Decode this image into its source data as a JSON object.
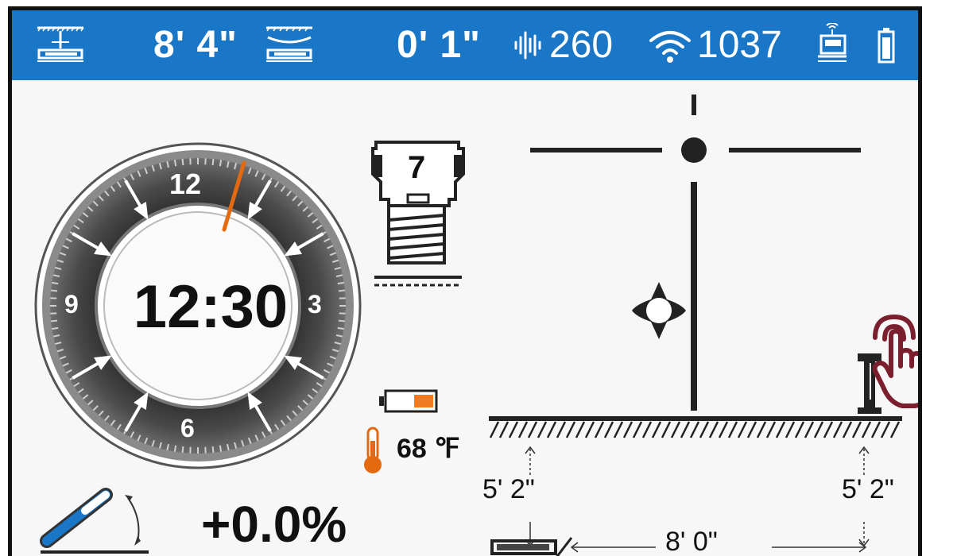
{
  "status_bar": {
    "depth_value": "8'  4\"",
    "pitch_depth_value": "0'  1\"",
    "signal_value": "260",
    "wifi_value": "1037",
    "colors": {
      "bar": "#1a76c6",
      "text": "#ffffff"
    },
    "icons": [
      "ground-depth-icon",
      "bore-depth-icon",
      "signal-strength-icon",
      "wifi-icon",
      "remote-device-icon",
      "battery-icon"
    ]
  },
  "clock": {
    "time": "12:30",
    "dial_labels": {
      "top": "12",
      "right": "3",
      "bottom": "6",
      "left": "9"
    },
    "pointer_color": "#e36a10"
  },
  "transmitter": {
    "frequency_label": "7",
    "battery_level": 0.4,
    "battery_color": "#f07b22",
    "temperature": "68 ℉"
  },
  "pitch": {
    "value": "+0.0%"
  },
  "locate_view": {
    "left_depth": "5'  2\"",
    "right_depth": "5'  2\"",
    "horizontal_distance": "8'  0\"",
    "touch_color": "#7b1e2e"
  }
}
